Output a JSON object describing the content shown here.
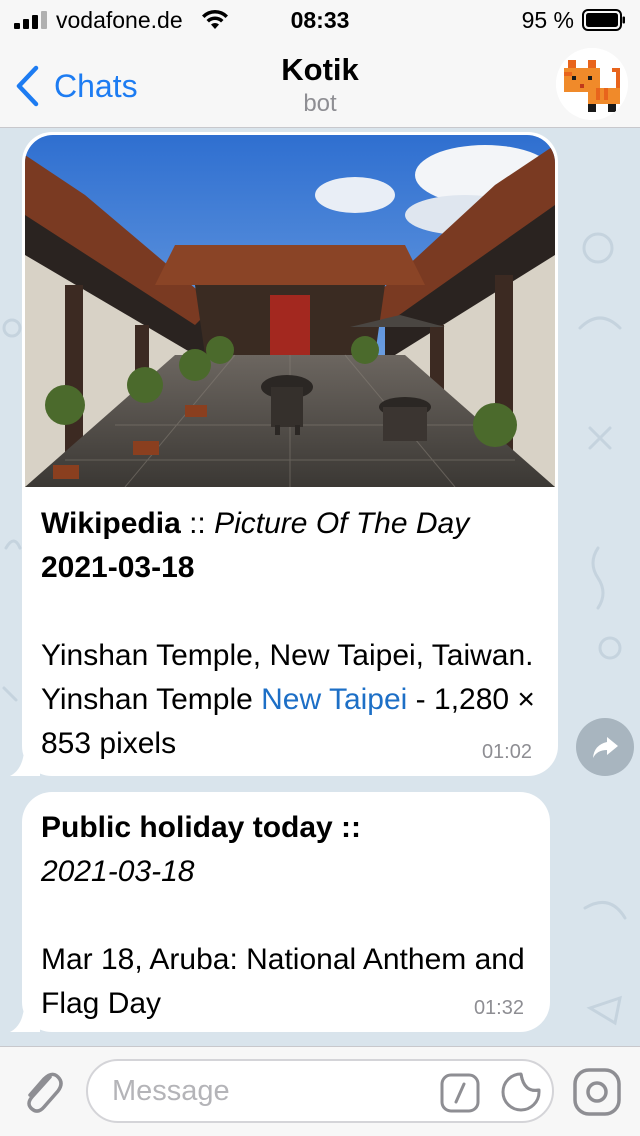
{
  "status_bar": {
    "carrier": "vodafone.de",
    "time": "08:33",
    "battery": "95 %"
  },
  "nav": {
    "back_label": "Chats",
    "title": "Kotik",
    "subtitle": "bot",
    "back_icon": "chevron-left-icon",
    "avatar_icon": "pixel-cat-avatar"
  },
  "messages": [
    {
      "photo": "temple-courtyard-photo",
      "source": "Wikipedia",
      "separator": " :: ",
      "heading_italic": "Picture Of The Day",
      "date": "2021-03-18",
      "body_part1": "Yinshan Temple, New Taipei, Taiwan. Yinshan Temple ",
      "link": "New Taipei",
      "body_part2": " - 1,280 × 853 pixels",
      "time": "01:02"
    },
    {
      "heading": "Public holiday today ::",
      "date_italic": "2021-03-18",
      "body": "Mar 18, Aruba: National Anthem and Flag Day",
      "time": "01:32"
    }
  ],
  "input": {
    "placeholder": "Message"
  },
  "colors": {
    "accent": "#1d7cf2",
    "link": "#1d6fc6",
    "chat_background": "#d9e4ec",
    "bar_background": "#f7f7f7"
  }
}
